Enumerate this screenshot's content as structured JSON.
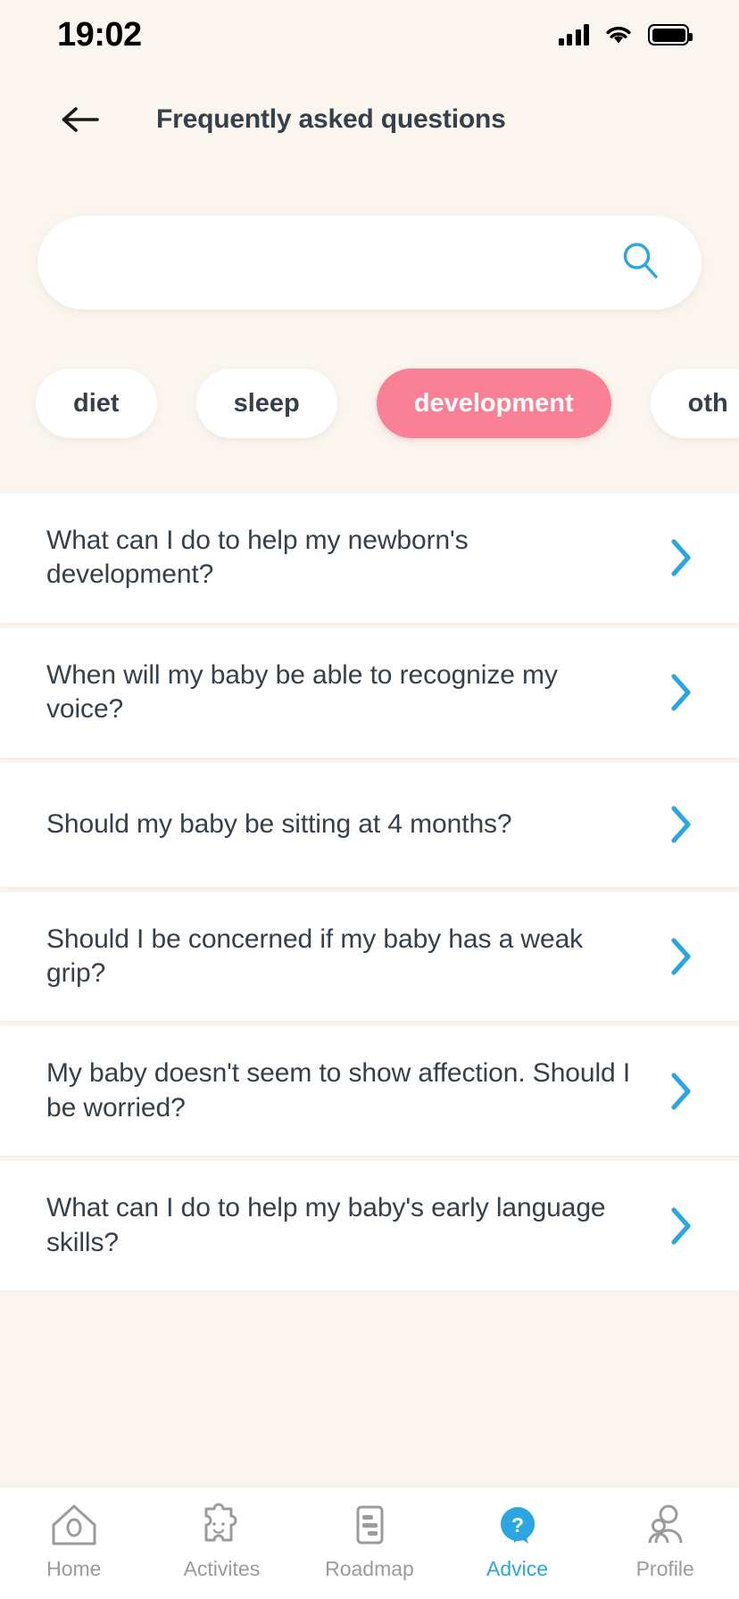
{
  "status_bar": {
    "time": "19:02",
    "cellular_icon": "cellular-signal-icon",
    "wifi_icon": "wifi-icon",
    "battery_icon": "battery-full-icon"
  },
  "header": {
    "back_icon": "back-arrow-icon",
    "title": "Frequently asked questions"
  },
  "search": {
    "value": "",
    "placeholder": "",
    "icon": "search-icon"
  },
  "categories": {
    "items": [
      {
        "label": "diet",
        "selected": false
      },
      {
        "label": "sleep",
        "selected": false
      },
      {
        "label": "development",
        "selected": true
      },
      {
        "label": "oth",
        "selected": false
      }
    ],
    "selected_color": "#fa8195"
  },
  "faq": {
    "chevron_icon": "chevron-right-icon",
    "chevron_color": "#2ba6e0",
    "items": [
      {
        "question": "What can I do to help my newborn's development?"
      },
      {
        "question": "When will my baby be able to recognize my voice?"
      },
      {
        "question": "Should my baby be sitting at 4 months?"
      },
      {
        "question": "Should I be concerned if my baby has a weak grip?"
      },
      {
        "question": "My baby doesn't seem to show affection. Should I be worried?"
      },
      {
        "question": "What can I do to help my baby's early language skills?"
      }
    ]
  },
  "bottom_nav": {
    "active_color": "#2ba6e0",
    "inactive_color": "#9b9b9b",
    "items": [
      {
        "label": "Home",
        "icon": "home-icon",
        "active": false
      },
      {
        "label": "Activites",
        "icon": "puzzle-icon",
        "active": false
      },
      {
        "label": "Roadmap",
        "icon": "document-icon",
        "active": false
      },
      {
        "label": "Advice",
        "icon": "question-bubble-icon",
        "active": true
      },
      {
        "label": "Profile",
        "icon": "profile-icon",
        "active": false
      }
    ]
  }
}
